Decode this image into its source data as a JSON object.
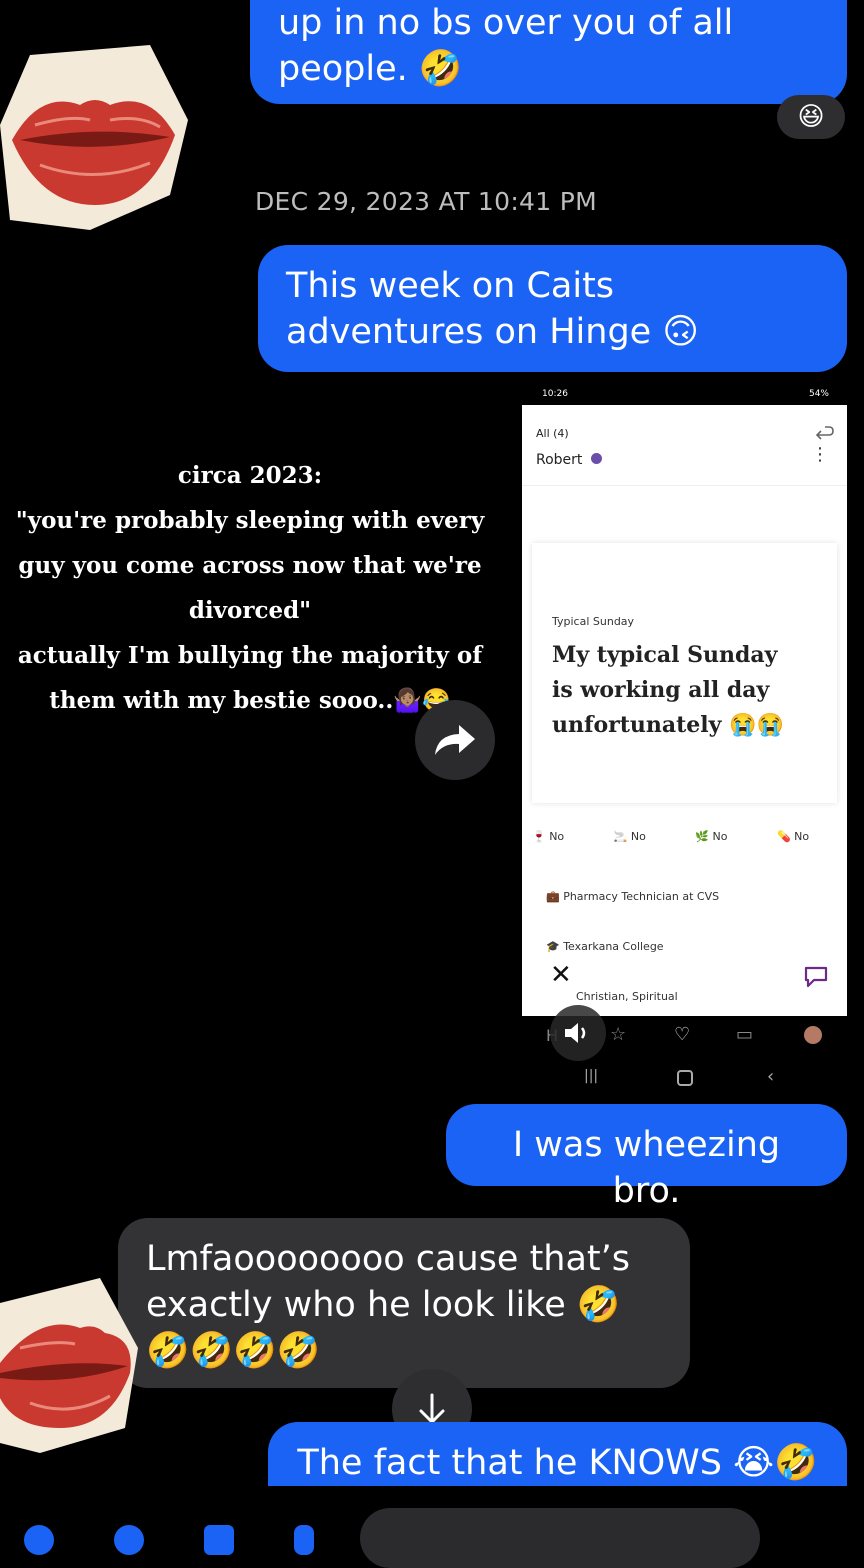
{
  "messages": {
    "m1": "up in no bs over you of all people. 🤣",
    "m1_reaction": "😆",
    "timestamp": "DEC 29, 2023 AT 10:41 PM",
    "m2": "This week on Caits adventures on Hinge 🙃",
    "m3": "I was wheezing bro.",
    "m4": "Lmfaoooooooo cause that’s exactly who he look like 🤣🤣🤣🤣🤣",
    "m5": "The fact that he KNOWS 😭🤣"
  },
  "overlay": {
    "line1": "circa 2023:",
    "line2": "\"you're probably sleeping with every guy you come across now that we're divorced\"",
    "line3": "actually I'm bullying the majority of them with my bestie sooo..🤷🏽‍♀️😂"
  },
  "screenshot": {
    "status_time": "10:26",
    "status_right": "54%",
    "breadcrumb": "All (4)",
    "name": "Robert",
    "prompt_label": "Typical Sunday",
    "prompt_answer": "My typical Sunday is working all day unfortunately 😭😭",
    "vitals": [
      "No",
      "No",
      "No",
      "No"
    ],
    "job": "Pharmacy Technician at CVS",
    "school": "Texarkana College",
    "religion": "Christian, Spiritual"
  },
  "colors": {
    "sent_bubble": "#1b63f5",
    "received_bubble": "#333335",
    "background": "#000000"
  },
  "icons": [
    "share-forward-icon",
    "scroll-down-arrow-icon",
    "volume-icon",
    "close-x-icon",
    "chat-icon",
    "more-vert-icon",
    "verified-badge-icon",
    "lips-sticker"
  ]
}
